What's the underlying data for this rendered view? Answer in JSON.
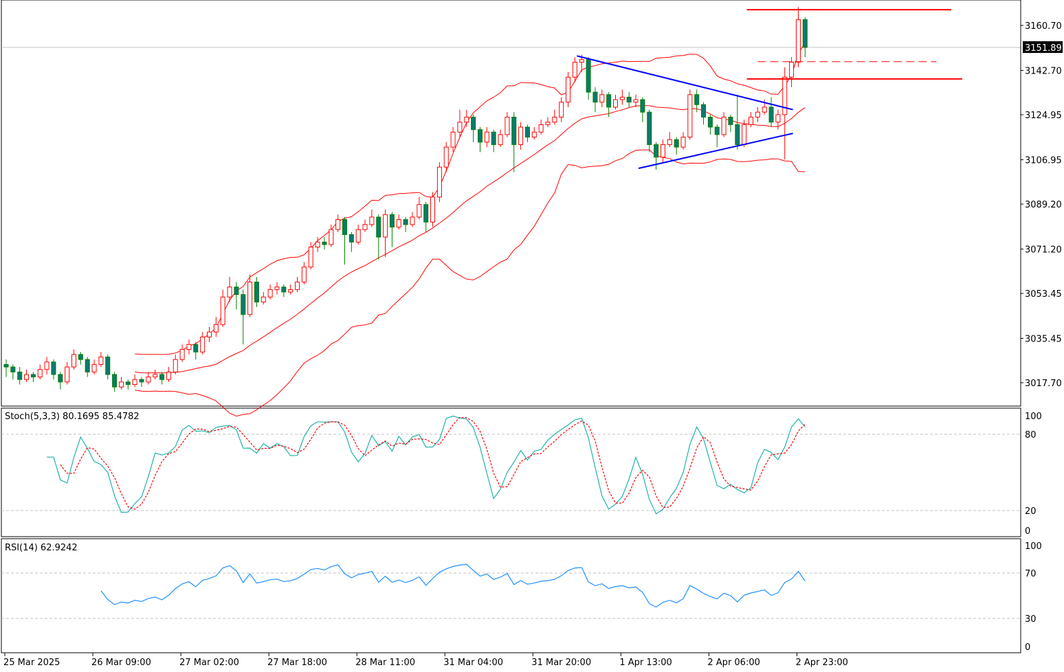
{
  "chart_data": {
    "type": "candlestick",
    "timeframe_note": "",
    "colors": {
      "bull_body": "#ffffff",
      "bull_outline": "#ff0000",
      "bear_body": "#0b7a6e",
      "bear_outline": "#008000",
      "bollinger": "#ff0000",
      "trendline": "#0000ff",
      "level": "#ff0000",
      "stoch_main": "#20b2aa",
      "stoch_signal": "#ff0000",
      "rsi": "#1e90ff",
      "grid_level": "#c0c0c0"
    },
    "price_axis": {
      "ylim": [
        3012,
        3170
      ],
      "ticks": [
        "3160.70",
        "3142.70",
        "3124.95",
        "3106.95",
        "3089.20",
        "3071.20",
        "3053.45",
        "3035.45",
        "3017.70"
      ],
      "current_price": "3151.89"
    },
    "time_labels": [
      {
        "bar": 0,
        "label": "25 Mar 2025"
      },
      {
        "bar": 13,
        "label": "26 Mar 09:00"
      },
      {
        "bar": 26,
        "label": "27 Mar 02:00"
      },
      {
        "bar": 39,
        "label": "27 Mar 18:00"
      },
      {
        "bar": 52,
        "label": "28 Mar 11:00"
      },
      {
        "bar": 65,
        "label": "31 Mar 04:00"
      },
      {
        "bar": 78,
        "label": "31 Mar 20:00"
      },
      {
        "bar": 91,
        "label": "1 Apr 13:00"
      },
      {
        "bar": 104,
        "label": "2 Apr 06:00"
      },
      {
        "bar": 117,
        "label": "2 Apr 23:00"
      }
    ],
    "candles": [
      [
        3025,
        3027,
        3020,
        3024
      ],
      [
        3024,
        3025,
        3019,
        3022
      ],
      [
        3022,
        3024,
        3017,
        3019
      ],
      [
        3019,
        3023,
        3018,
        3021
      ],
      [
        3021,
        3022,
        3018,
        3020
      ],
      [
        3020,
        3025,
        3019,
        3023
      ],
      [
        3023,
        3028,
        3021,
        3026
      ],
      [
        3026,
        3027,
        3019,
        3021
      ],
      [
        3021,
        3022,
        3015,
        3018
      ],
      [
        3018,
        3026,
        3017,
        3024
      ],
      [
        3024,
        3031,
        3023,
        3029
      ],
      [
        3029,
        3030,
        3025,
        3027
      ],
      [
        3027,
        3028,
        3020,
        3022
      ],
      [
        3022,
        3027,
        3021,
        3025
      ],
      [
        3025,
        3030,
        3024,
        3028
      ],
      [
        3028,
        3029,
        3019,
        3021
      ],
      [
        3021,
        3022,
        3014,
        3016
      ],
      [
        3016,
        3020,
        3015,
        3018
      ],
      [
        3018,
        3019,
        3015,
        3017
      ],
      [
        3017,
        3021,
        3016,
        3019
      ],
      [
        3019,
        3020,
        3016,
        3018
      ],
      [
        3018,
        3022,
        3017,
        3020
      ],
      [
        3020,
        3023,
        3019,
        3021
      ],
      [
        3021,
        3022,
        3017,
        3019
      ],
      [
        3019,
        3024,
        3018,
        3022
      ],
      [
        3022,
        3029,
        3021,
        3027
      ],
      [
        3027,
        3033,
        3026,
        3031
      ],
      [
        3031,
        3035,
        3029,
        3033
      ],
      [
        3033,
        3034,
        3027,
        3030
      ],
      [
        3030,
        3038,
        3029,
        3036
      ],
      [
        3036,
        3040,
        3034,
        3038
      ],
      [
        3038,
        3044,
        3036,
        3041
      ],
      [
        3041,
        3055,
        3040,
        3052
      ],
      [
        3052,
        3060,
        3050,
        3056
      ],
      [
        3056,
        3058,
        3047,
        3053
      ],
      [
        3053,
        3055,
        3033,
        3045
      ],
      [
        3045,
        3061,
        3044,
        3058
      ],
      [
        3058,
        3060,
        3048,
        3050
      ],
      [
        3050,
        3054,
        3049,
        3052
      ],
      [
        3052,
        3057,
        3051,
        3055
      ],
      [
        3055,
        3058,
        3053,
        3056
      ],
      [
        3056,
        3057,
        3052,
        3054
      ],
      [
        3054,
        3057,
        3053,
        3055
      ],
      [
        3055,
        3060,
        3054,
        3058
      ],
      [
        3058,
        3066,
        3057,
        3064
      ],
      [
        3064,
        3074,
        3063,
        3072
      ],
      [
        3072,
        3076,
        3070,
        3074
      ],
      [
        3074,
        3076,
        3071,
        3073
      ],
      [
        3073,
        3081,
        3072,
        3079
      ],
      [
        3079,
        3085,
        3078,
        3083
      ],
      [
        3083,
        3084,
        3065,
        3077
      ],
      [
        3077,
        3078,
        3070,
        3074
      ],
      [
        3074,
        3081,
        3073,
        3079
      ],
      [
        3079,
        3083,
        3078,
        3081
      ],
      [
        3081,
        3087,
        3080,
        3084
      ],
      [
        3084,
        3085,
        3067,
        3076
      ],
      [
        3076,
        3087,
        3068,
        3085
      ],
      [
        3085,
        3086,
        3072,
        3080
      ],
      [
        3080,
        3085,
        3079,
        3083
      ],
      [
        3083,
        3084,
        3078,
        3081
      ],
      [
        3081,
        3086,
        3080,
        3084
      ],
      [
        3084,
        3092,
        3083,
        3089
      ],
      [
        3089,
        3090,
        3078,
        3082
      ],
      [
        3082,
        3094,
        3080,
        3092
      ],
      [
        3092,
        3106,
        3090,
        3104
      ],
      [
        3104,
        3114,
        3102,
        3112
      ],
      [
        3112,
        3120,
        3110,
        3118
      ],
      [
        3118,
        3127,
        3116,
        3122
      ],
      [
        3122,
        3127,
        3120,
        3124
      ],
      [
        3124,
        3125,
        3114,
        3119
      ],
      [
        3119,
        3120,
        3110,
        3114
      ],
      [
        3114,
        3120,
        3112,
        3118
      ],
      [
        3118,
        3119,
        3110,
        3113
      ],
      [
        3113,
        3119,
        3112,
        3117
      ],
      [
        3117,
        3126,
        3116,
        3124
      ],
      [
        3124,
        3126,
        3102,
        3113
      ],
      [
        3113,
        3122,
        3111,
        3120
      ],
      [
        3120,
        3121,
        3114,
        3116
      ],
      [
        3116,
        3120,
        3115,
        3118
      ],
      [
        3118,
        3123,
        3117,
        3121
      ],
      [
        3121,
        3124,
        3120,
        3122
      ],
      [
        3122,
        3127,
        3121,
        3124
      ],
      [
        3124,
        3132,
        3122,
        3130
      ],
      [
        3130,
        3142,
        3128,
        3140
      ],
      [
        3140,
        3148,
        3138,
        3146
      ],
      [
        3146,
        3149,
        3142,
        3147
      ],
      [
        3147,
        3148,
        3131,
        3134
      ],
      [
        3134,
        3136,
        3126,
        3130
      ],
      [
        3130,
        3135,
        3128,
        3133
      ],
      [
        3133,
        3134,
        3124,
        3128
      ],
      [
        3128,
        3133,
        3127,
        3131
      ],
      [
        3131,
        3135,
        3129,
        3132
      ],
      [
        3132,
        3134,
        3128,
        3130
      ],
      [
        3130,
        3133,
        3128,
        3131
      ],
      [
        3131,
        3132,
        3122,
        3126
      ],
      [
        3126,
        3127,
        3110,
        3113
      ],
      [
        3113,
        3114,
        3103,
        3108
      ],
      [
        3108,
        3115,
        3106,
        3113
      ],
      [
        3113,
        3118,
        3112,
        3115
      ],
      [
        3115,
        3116,
        3109,
        3112
      ],
      [
        3112,
        3118,
        3111,
        3116
      ],
      [
        3116,
        3135,
        3115,
        3133
      ],
      [
        3133,
        3135,
        3126,
        3129
      ],
      [
        3129,
        3130,
        3121,
        3124
      ],
      [
        3124,
        3125,
        3117,
        3120
      ],
      [
        3120,
        3121,
        3112,
        3117
      ],
      [
        3117,
        3126,
        3116,
        3124
      ],
      [
        3124,
        3125,
        3118,
        3121
      ],
      [
        3121,
        3133,
        3111,
        3113
      ],
      [
        3113,
        3123,
        3112,
        3121
      ],
      [
        3121,
        3126,
        3120,
        3124
      ],
      [
        3124,
        3128,
        3122,
        3126
      ],
      [
        3126,
        3131,
        3125,
        3128
      ],
      [
        3128,
        3132,
        3120,
        3122
      ],
      [
        3122,
        3127,
        3119,
        3125
      ],
      [
        3125,
        3144,
        3107,
        3140
      ],
      [
        3140,
        3148,
        3136,
        3146
      ],
      [
        3146,
        3168,
        3144,
        3163
      ],
      [
        3163,
        3164,
        3148,
        3151.89
      ]
    ],
    "overlays": {
      "bollinger": {
        "period": 20,
        "deviation": 2
      },
      "trendlines": [
        {
          "name": "triangle-upper",
          "from": [
            84.3,
            3148.5
          ],
          "to": [
            116.2,
            3127
          ]
        },
        {
          "name": "triangle-lower",
          "from": [
            93.4,
            3103.5
          ],
          "to": [
            116.2,
            3117.5
          ]
        }
      ],
      "levels": [
        {
          "name": "resistance",
          "price": 3167,
          "from_bar": 109.4,
          "to_bar": 139.6,
          "style": "solid"
        },
        {
          "name": "support",
          "price": 3139.3,
          "from_bar": 109.4,
          "to_bar": 141.2,
          "style": "solid"
        },
        {
          "name": "mid",
          "price": 3146.2,
          "from_bar": 111,
          "to_bar": 137.4,
          "style": "dashed"
        }
      ]
    },
    "stochastic": {
      "title": "Stoch(5,3,3) 80.1695 85.4782",
      "k": 5,
      "d": 3,
      "slowing": 3,
      "levels": [
        20,
        80
      ],
      "ticks": [
        "100",
        "80",
        "20",
        "0"
      ]
    },
    "rsi": {
      "title": "RSI(14) 62.9242",
      "period": 14,
      "levels": [
        30,
        70
      ],
      "ticks": [
        "100",
        "70",
        "30",
        "0"
      ]
    }
  }
}
